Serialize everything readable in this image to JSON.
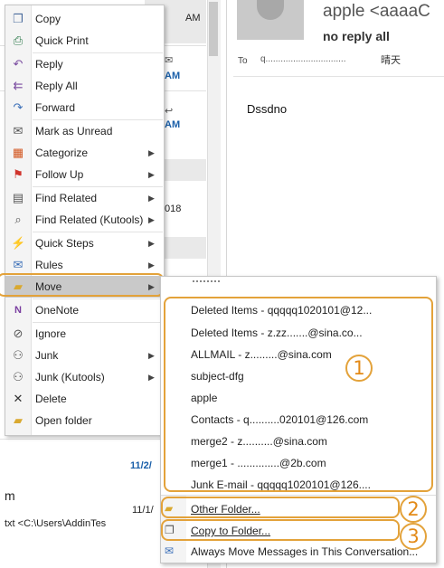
{
  "background": {
    "list_times": [
      "AM",
      "AM",
      "AM"
    ],
    "list_date_fragment": "018",
    "list_bottom": {
      "date1": "11/2/",
      "date2": "11/1/",
      "fragment": "m",
      "path": "txt <C:\\Users\\AddinTes"
    }
  },
  "reading_pane": {
    "sender": "apple <aaaaC",
    "subject": "no reply all",
    "to_label": "To",
    "to_address": "q................................",
    "to_extra": "晴天",
    "body": "Dssdno"
  },
  "context_menu": {
    "items": [
      {
        "name": "copy",
        "label": "Copy",
        "icon": "copy-icon",
        "submenu": false
      },
      {
        "name": "quick-print",
        "label": "Quick Print",
        "icon": "printer-icon",
        "submenu": false
      },
      {
        "name": "reply",
        "label": "Reply",
        "icon": "reply-icon",
        "submenu": false
      },
      {
        "name": "reply-all",
        "label": "Reply All",
        "icon": "reply-all-icon",
        "submenu": false
      },
      {
        "name": "forward",
        "label": "Forward",
        "icon": "forward-icon",
        "submenu": false
      },
      {
        "name": "mark-as-unread",
        "label": "Mark as Unread",
        "icon": "envelope-icon",
        "submenu": false
      },
      {
        "name": "categorize",
        "label": "Categorize",
        "icon": "categorize-icon",
        "submenu": true
      },
      {
        "name": "follow-up",
        "label": "Follow Up",
        "icon": "flag-icon",
        "submenu": true
      },
      {
        "name": "find-related",
        "label": "Find Related",
        "icon": "find-related-icon",
        "submenu": true
      },
      {
        "name": "find-related-kutools",
        "label": "Find Related (Kutools)",
        "icon": "find-related-kutools-icon",
        "submenu": true
      },
      {
        "name": "quick-steps",
        "label": "Quick Steps",
        "icon": "lightning-icon",
        "submenu": true
      },
      {
        "name": "rules",
        "label": "Rules",
        "icon": "rules-icon",
        "submenu": true
      },
      {
        "name": "move",
        "label": "Move",
        "icon": "move-folder-icon",
        "submenu": true
      },
      {
        "name": "onenote",
        "label": "OneNote",
        "icon": "onenote-icon",
        "submenu": false
      },
      {
        "name": "ignore",
        "label": "Ignore",
        "icon": "ignore-icon",
        "submenu": false
      },
      {
        "name": "junk",
        "label": "Junk",
        "icon": "junk-icon",
        "submenu": true
      },
      {
        "name": "junk-kutools",
        "label": "Junk (Kutools)",
        "icon": "junk-kutools-icon",
        "submenu": true
      },
      {
        "name": "delete",
        "label": "Delete",
        "icon": "delete-icon",
        "submenu": false
      },
      {
        "name": "open-folder",
        "label": "Open folder",
        "icon": "open-folder-icon",
        "submenu": false
      }
    ]
  },
  "move_submenu": {
    "folders": [
      "Deleted Items - qqqqq1020101@12...",
      "Deleted Items - z.zz.......@sina.co...",
      "ALLMAIL - z.........@sina.com",
      "subject-dfg",
      "apple",
      "Contacts - q..........020101@126.com",
      "merge2 - z..........@sina.com",
      "merge1 - ..............@2b.com",
      "Junk E-mail - qqqqq1020101@126...."
    ],
    "other_folder": "Other Folder...",
    "copy_to_folder": "Copy to Folder...",
    "always_move": "Always Move Messages in This Conversation..."
  },
  "callouts": [
    "1",
    "2",
    "3"
  ],
  "colors": {
    "highlight": "#e3a23a",
    "callout_text": "#e38a17",
    "link_blue": "#1a5fa9"
  }
}
